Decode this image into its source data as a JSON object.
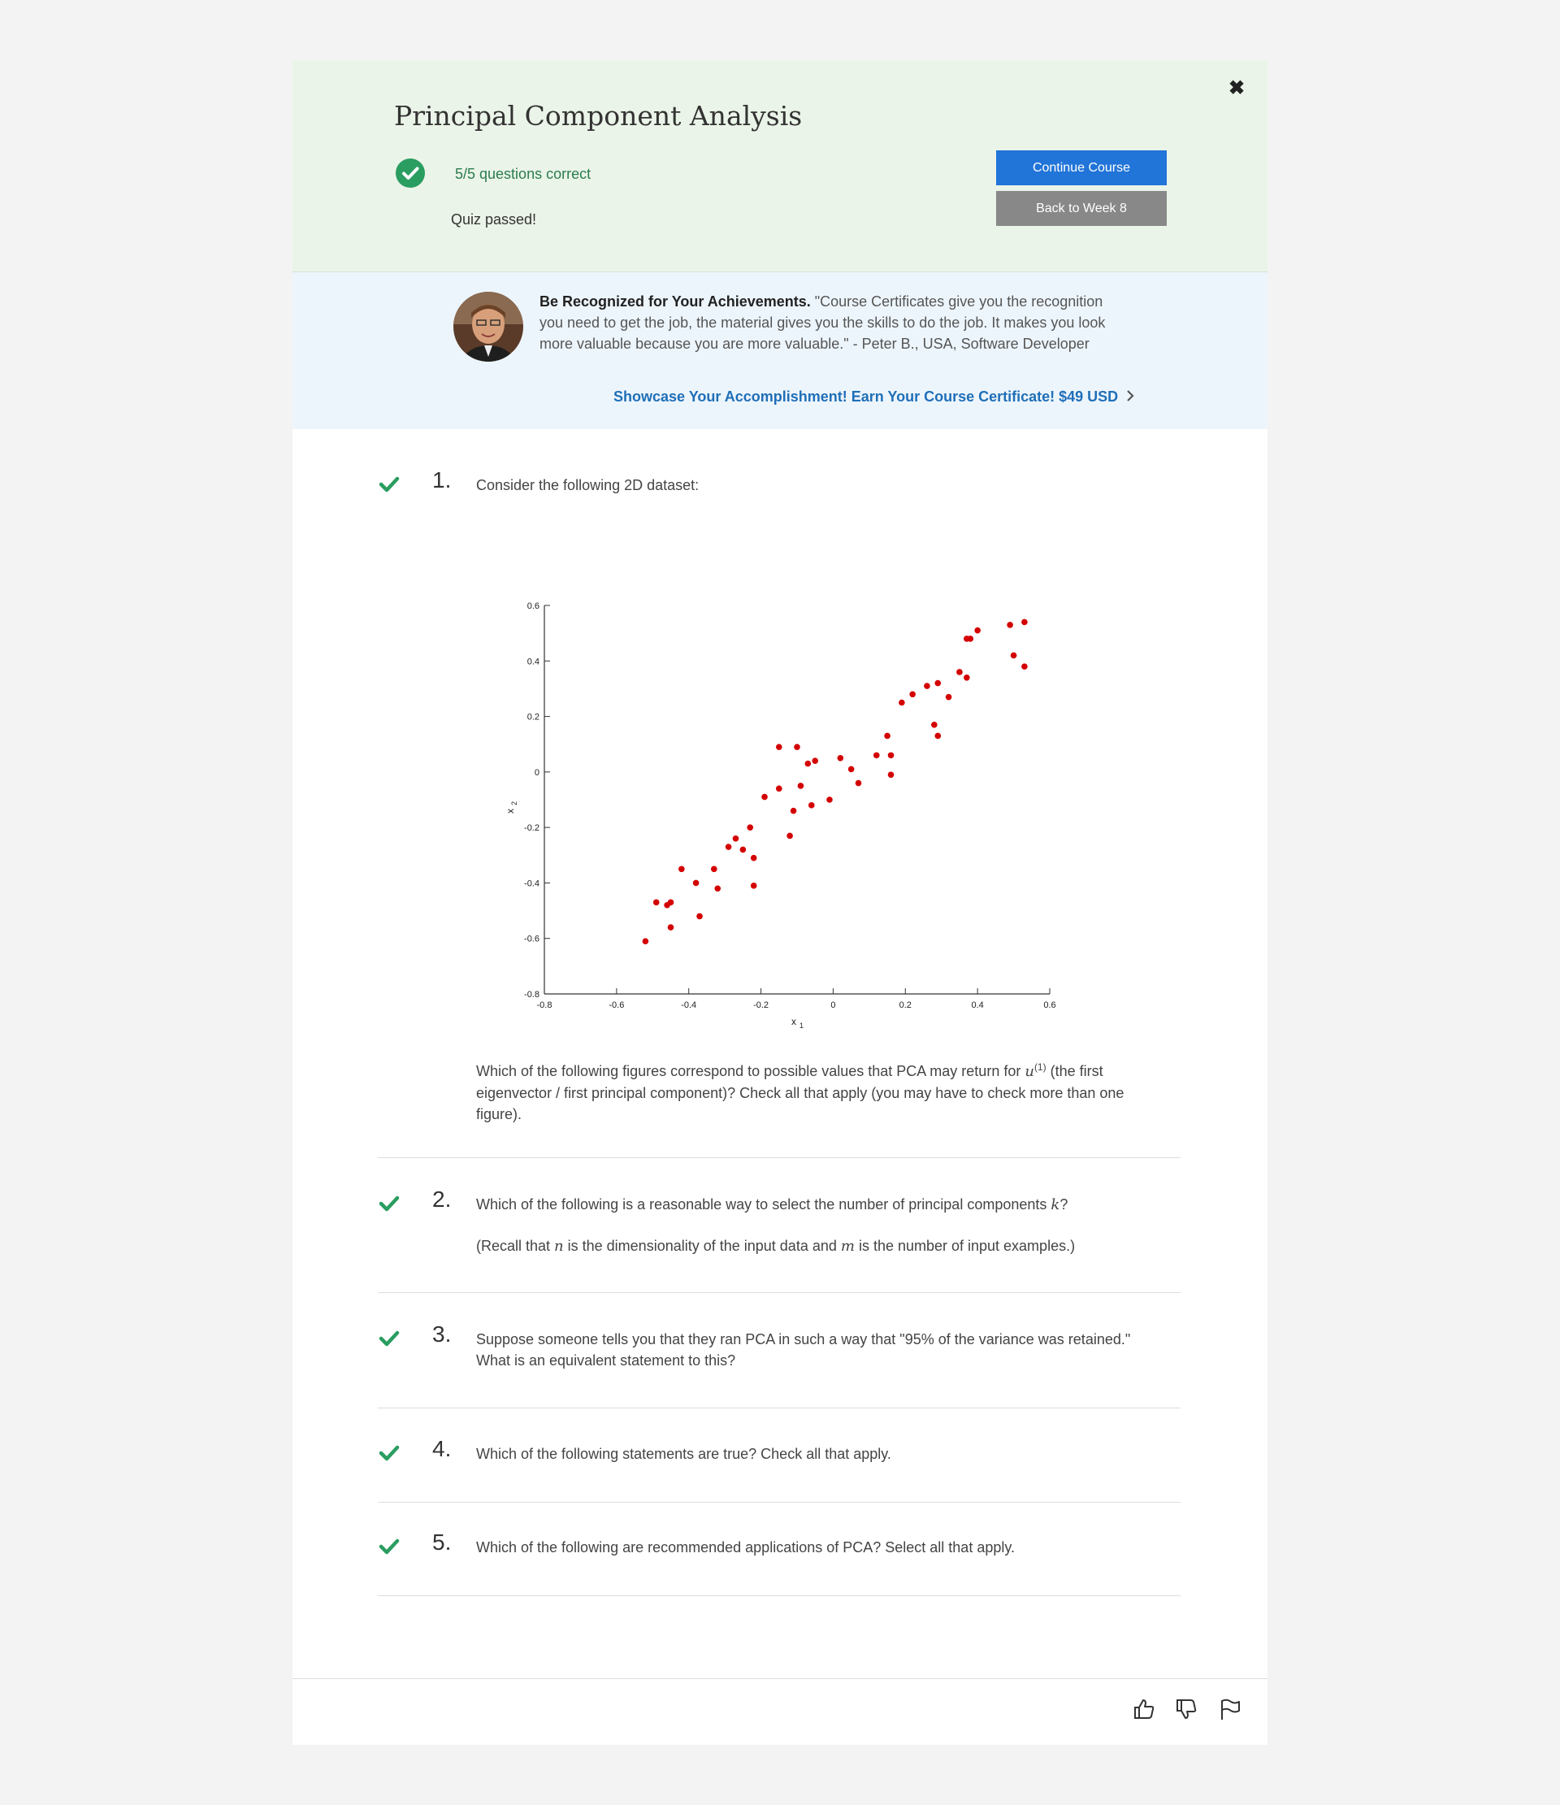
{
  "header": {
    "title": "Principal Component Analysis",
    "score": "5/5 questions correct",
    "status": "Quiz passed!",
    "continue_label": "Continue Course",
    "back_label": "Back to Week 8",
    "close_glyph": "✖",
    "pass_icon": "check-circle-icon",
    "accent_color": "#2a9d60"
  },
  "promo": {
    "heading": "Be Recognized for Your Achievements.",
    "quote": " \"Course Certificates give you the recognition you need to get the job, the material gives you the skills to do the job. It makes you look more valuable because you are more valuable.\" - Peter B., USA, Software Developer",
    "link": "Showcase Your Accomplishment! Earn Your Course Certificate! $49 USD",
    "link_color": "#1f6fb8"
  },
  "questions": [
    {
      "number": "1.",
      "text": "Consider the following 2D dataset:",
      "followup_a": "Which of the following figures correspond to possible values that PCA may return for ",
      "followup_var": "u",
      "followup_sup": "(1)",
      "followup_b": " (the first eigenvector / first principal component)? Check all that apply (you may have to check more than one figure)."
    },
    {
      "number": "2.",
      "text_a": "Which of the following is a reasonable way to select the number of principal components ",
      "text_var": "k",
      "text_b": "?",
      "note_a": "(Recall that ",
      "note_var1": "n",
      "note_b": " is the dimensionality of the input data and ",
      "note_var2": "m",
      "note_c": " is the number of input examples.)"
    },
    {
      "number": "3.",
      "text": "Suppose someone tells you that they ran PCA in such a way that \"95% of the variance was retained.\" What is an equivalent statement to this?"
    },
    {
      "number": "4.",
      "text": "Which of the following statements are true? Check all that apply."
    },
    {
      "number": "5.",
      "text": "Which of the following are recommended applications of PCA? Select all that apply."
    }
  ],
  "footer": {
    "icons": [
      "thumbs-up-icon",
      "thumbs-down-icon",
      "flag-icon"
    ]
  },
  "chart_data": {
    "type": "scatter",
    "xlabel": "x",
    "xlabel_sub": "1",
    "ylabel": "x",
    "ylabel_sub": "2",
    "xlim": [
      -0.8,
      0.6
    ],
    "ylim": [
      -0.8,
      0.6
    ],
    "x_ticks": [
      "-0.8",
      "-0.6",
      "-0.4",
      "-0.2",
      "0",
      "0.2",
      "0.4",
      "0.6"
    ],
    "y_ticks": [
      "-0.8",
      "-0.6",
      "-0.4",
      "-0.2",
      "0",
      "0.2",
      "0.4",
      "0.6"
    ],
    "point_color": "#d40000",
    "points": [
      [
        -0.52,
        -0.61
      ],
      [
        -0.49,
        -0.47
      ],
      [
        -0.46,
        -0.48
      ],
      [
        -0.45,
        -0.47
      ],
      [
        -0.45,
        -0.56
      ],
      [
        -0.42,
        -0.35
      ],
      [
        -0.38,
        -0.4
      ],
      [
        -0.37,
        -0.52
      ],
      [
        -0.33,
        -0.35
      ],
      [
        -0.32,
        -0.42
      ],
      [
        -0.29,
        -0.27
      ],
      [
        -0.27,
        -0.24
      ],
      [
        -0.25,
        -0.28
      ],
      [
        -0.23,
        -0.2
      ],
      [
        -0.22,
        -0.31
      ],
      [
        -0.22,
        -0.41
      ],
      [
        -0.19,
        -0.09
      ],
      [
        -0.15,
        0.09
      ],
      [
        -0.15,
        -0.06
      ],
      [
        -0.12,
        -0.23
      ],
      [
        -0.11,
        -0.14
      ],
      [
        -0.1,
        0.09
      ],
      [
        -0.09,
        -0.05
      ],
      [
        -0.07,
        0.03
      ],
      [
        -0.06,
        -0.12
      ],
      [
        -0.05,
        0.04
      ],
      [
        -0.01,
        -0.1
      ],
      [
        0.02,
        0.05
      ],
      [
        0.05,
        0.01
      ],
      [
        0.07,
        -0.04
      ],
      [
        0.12,
        0.06
      ],
      [
        0.15,
        0.13
      ],
      [
        0.16,
        0.06
      ],
      [
        0.16,
        -0.01
      ],
      [
        0.19,
        0.25
      ],
      [
        0.22,
        0.28
      ],
      [
        0.26,
        0.31
      ],
      [
        0.28,
        0.17
      ],
      [
        0.29,
        0.13
      ],
      [
        0.29,
        0.32
      ],
      [
        0.32,
        0.27
      ],
      [
        0.35,
        0.36
      ],
      [
        0.37,
        0.34
      ],
      [
        0.37,
        0.48
      ],
      [
        0.38,
        0.48
      ],
      [
        0.4,
        0.51
      ],
      [
        0.49,
        0.53
      ],
      [
        0.5,
        0.42
      ],
      [
        0.53,
        0.54
      ],
      [
        0.53,
        0.38
      ]
    ]
  }
}
